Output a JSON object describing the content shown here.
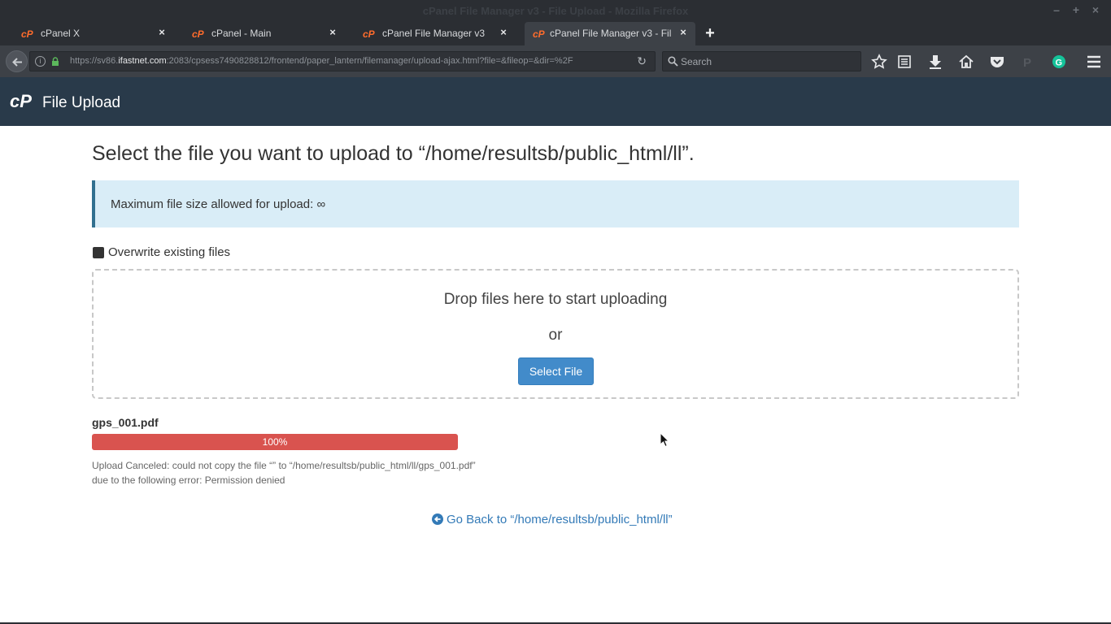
{
  "window": {
    "title": "cPanel File Manager v3 - File Upload - Mozilla Firefox"
  },
  "tabs": [
    {
      "label": "cPanel X",
      "active": false
    },
    {
      "label": "cPanel - Main",
      "active": false
    },
    {
      "label": "cPanel File Manager v3",
      "active": false
    },
    {
      "label": "cPanel File Manager v3 - Fil...",
      "active": true
    }
  ],
  "nav": {
    "url_prefix": "https://sv86.",
    "url_domain": "ifastnet.com",
    "url_rest": ":2083/cpsess7490828812/frontend/paper_lantern/filemanager/upload-ajax.html?file=&fileop=&dir=%2F",
    "search_placeholder": "Search"
  },
  "header": {
    "title": "File Upload"
  },
  "main": {
    "heading": "Select the file you want to upload to “/home/resultsb/public_html/ll”.",
    "max_size_text": "Maximum file size allowed for upload: ∞",
    "overwrite_label": "Overwrite existing files",
    "overwrite_checked": false,
    "drop_text": "Drop files here to start uploading",
    "or_text": "or",
    "select_button": "Select File"
  },
  "upload": {
    "filename": "gps_001.pdf",
    "progress_percent": 100,
    "progress_label": "100%",
    "bar_color": "#d9534f",
    "error_line1": "Upload Canceled: could not copy the file “” to “/home/resultsb/public_html/ll/gps_001.pdf”",
    "error_line2": "due to the following error: Permission denied"
  },
  "footer": {
    "go_back": "Go Back to “/home/resultsb/public_html/ll”"
  },
  "colors": {
    "header_bg": "#293a4a",
    "accent": "#428bca",
    "alert_bg": "#d9edf7",
    "link": "#337ab7",
    "cpanel_orange": "#ff6c2c"
  }
}
